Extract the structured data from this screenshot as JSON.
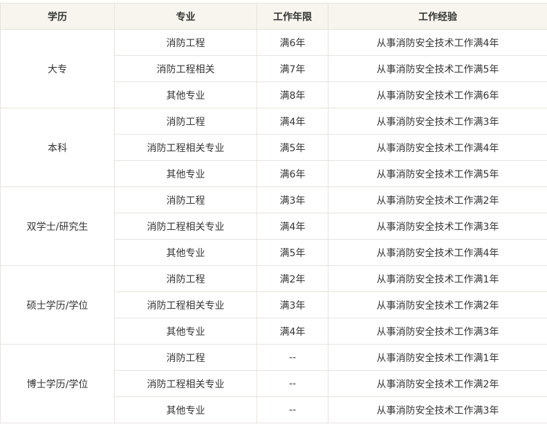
{
  "headers": [
    "学历",
    "专业",
    "工作年限",
    "工作经验"
  ],
  "groups": [
    {
      "degree": "大专",
      "rows": [
        {
          "major": "消防工程",
          "years": "满6年",
          "experience": "从事消防安全技术工作满4年"
        },
        {
          "major": "消防工程相关",
          "years": "满7年",
          "experience": "从事消防安全技术工作满5年"
        },
        {
          "major": "其他专业",
          "years": "满8年",
          "experience": "从事消防安全技术工作满6年"
        }
      ]
    },
    {
      "degree": "本科",
      "rows": [
        {
          "major": "消防工程",
          "years": "满4年",
          "experience": "从事消防安全技术工作满3年"
        },
        {
          "major": "消防工程相关专业",
          "years": "满5年",
          "experience": "从事消防安全技术工作满4年"
        },
        {
          "major": "其他专业",
          "years": "满6年",
          "experience": "从事消防安全技术工作满5年"
        }
      ]
    },
    {
      "degree": "双学士/研究生",
      "rows": [
        {
          "major": "消防工程",
          "years": "满3年",
          "experience": "从事消防安全技术工作满2年"
        },
        {
          "major": "消防工程相关专业",
          "years": "满4年",
          "experience": "从事消防安全技术工作满3年"
        },
        {
          "major": "其他专业",
          "years": "满5年",
          "experience": "从事消防安全技术工作满4年"
        }
      ]
    },
    {
      "degree": "硕士学历/学位",
      "rows": [
        {
          "major": "消防工程",
          "years": "满2年",
          "experience": "从事消防安全技术工作满1年"
        },
        {
          "major": "消防工程相关专业",
          "years": "满3年",
          "experience": "从事消防安全技术工作满2年"
        },
        {
          "major": "其他专业",
          "years": "满4年",
          "experience": "从事消防安全技术工作满3年"
        }
      ]
    },
    {
      "degree": "博士学历/学位",
      "rows": [
        {
          "major": "消防工程",
          "years": "--",
          "experience": "从事消防安全技术工作满1年"
        },
        {
          "major": "消防工程相关专业",
          "years": "--",
          "experience": "从事消防安全技术工作满2年"
        },
        {
          "major": "其他专业",
          "years": "--",
          "experience": "从事消防安全技术工作满3年"
        }
      ]
    }
  ]
}
